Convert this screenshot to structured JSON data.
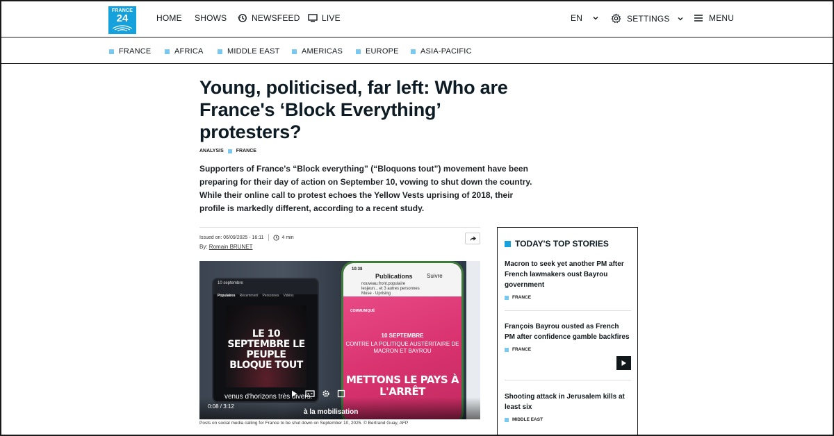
{
  "header": {
    "logo": {
      "line1": "FRANCE",
      "line2": "24"
    },
    "nav": {
      "home": "HOME",
      "shows": "SHOWS",
      "newsfeed": "NEWSFEED",
      "live": "LIVE",
      "language": "EN",
      "settings": "SETTINGS",
      "menu": "MENU"
    }
  },
  "regions": [
    "FRANCE",
    "AFRICA",
    "MIDDLE EAST",
    "AMERICAS",
    "EUROPE",
    "ASIA-PACIFIC"
  ],
  "article": {
    "title": "Young, politicised, far left: Who are France's ‘Block Everything’ protesters?",
    "tag_type": "ANALYSIS",
    "tag_region": "FRANCE",
    "lede": "Supporters of France's “Block everything” (“Bloquons tout”) movement have been preparing for their day of action on September 10, vowing to shut down the country. While their online call to protest echoes the Yellow Vests uprising of 2018, their profile is markedly different, according to a recent study.",
    "issued": "Issued on: 06/09/2025 - 16:11",
    "read_time": "4 min",
    "by_label": "By:",
    "author": "Romain BRUNET",
    "caption": "Posts on social media calling for France to be shut down on September 10, 2025. © Bertrand Guay, AFP"
  },
  "media": {
    "phone1": {
      "search": "10 septembre",
      "tabs": [
        "Populaires",
        "Récemment",
        "Personnes",
        "Vidéos"
      ],
      "poster": "LE 10 SEPTEMBRE LE PEUPLE BLOQUE TOUT"
    },
    "phone2": {
      "time": "10:38",
      "title": "Publications",
      "follow": "Suivre",
      "account": "nouveau.front.populaire",
      "collab": "lesjeun... et 3 autres personnes",
      "music": "Muse · Uprising",
      "communique": "COMMUNIQUÉ",
      "date": "10 SEPTEMBRE",
      "against": "CONTRE LA POLITIQUE AUSTÉRITAIRE DE MACRON ET BAYROU",
      "slogan": "METTONS LE PAYS À L'ARRÊT"
    },
    "overlay_text": "venus d'horizons très divers.",
    "overlay_text2": "à la mobilisation",
    "time": "0:08 / 3:12"
  },
  "sidebar": {
    "heading": "TODAY'S TOP STORIES",
    "stories": [
      {
        "title": "Macron to seek yet another PM after French lawmakers oust Bayrou government",
        "tag": "FRANCE"
      },
      {
        "title": "François Bayrou ousted as French PM after confidence gamble backfires",
        "tag": "FRANCE"
      },
      {
        "title": "Shooting attack in Jerusalem kills at least six",
        "tag": "MIDDLE EAST"
      }
    ]
  },
  "colors": {
    "accent": "#14a1dc",
    "tag_square": "#78c8f0",
    "text": "#11181c"
  }
}
